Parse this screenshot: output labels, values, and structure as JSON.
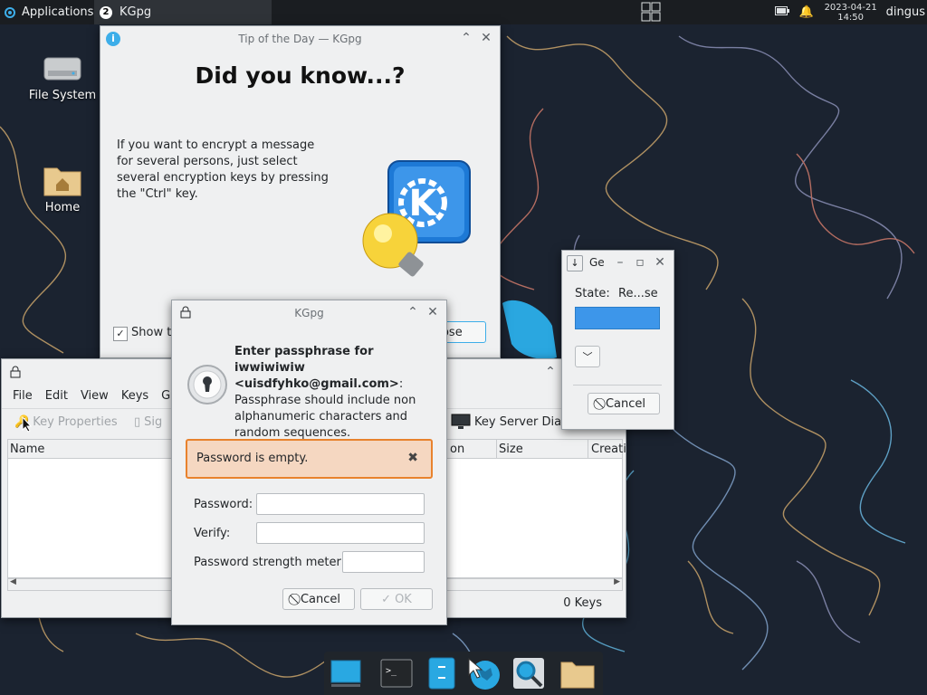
{
  "panel": {
    "apps_label": "Applications",
    "task_badge": "2",
    "task_label": "KGpg",
    "clock_date": "2023-04-21",
    "clock_time": "14:50",
    "user": "dingus"
  },
  "desktop_icons": {
    "filesystem": "File System",
    "home": "Home"
  },
  "tip_window": {
    "title": "Tip of the Day — KGpg",
    "heading": "Did you know...?",
    "tip_text": "If you want to encrypt a message for several persons, just select several encryption keys by pressing the \"Ctrl\" key.",
    "show_tips_label": "Show ti",
    "close_label": "Close"
  },
  "kgpg_main": {
    "menu": [
      "File",
      "Edit",
      "View",
      "Keys",
      "Gr"
    ],
    "toolbar_key_props": "Key Properties",
    "toolbar_sign": "Sig",
    "toolbar_keyserver": "Key Server Dialo",
    "col_name": "Name",
    "col_on": "on",
    "col_size": "Size",
    "col_creation": "Creati",
    "status_keys": "0 Keys"
  },
  "gen_window": {
    "title": "Ge",
    "state_label": "State:",
    "state_value": "Re...se",
    "cancel_label": "Cancel"
  },
  "pass_dialog": {
    "title": "KGpg",
    "prompt_bold": "Enter passphrase for iwwiwiwiw <uisdfyhko@gmail.com>",
    "prompt_rest": ": Passphrase should include non alphanumeric characters and random sequences.",
    "error_msg": "Password is empty.",
    "password_label": "Password:",
    "verify_label": "Verify:",
    "meter_label": "Password strength meter:",
    "password_value": "",
    "verify_value": "",
    "cancel_label": "Cancel",
    "ok_label": "OK"
  },
  "colors": {
    "accent": "#3daee9",
    "error_bg": "#f5d7c1",
    "error_border": "#e8822d"
  }
}
